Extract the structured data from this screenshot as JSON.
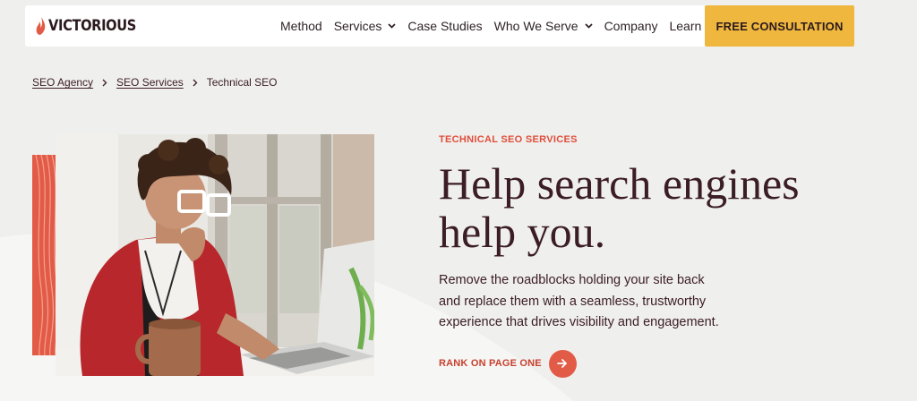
{
  "brand": {
    "name": "VICTORIOUS",
    "accent": "#e25b47",
    "cta_color": "#efb73e",
    "text_color": "#3b1d24"
  },
  "nav": {
    "items": [
      {
        "label": "Method"
      },
      {
        "label": "Services",
        "dropdown": true
      },
      {
        "label": "Case Studies"
      },
      {
        "label": "Who We Serve",
        "dropdown": true
      },
      {
        "label": "Company"
      },
      {
        "label": "Learn"
      }
    ],
    "cta": "FREE CONSULTATION"
  },
  "breadcrumb": [
    "SEO Agency",
    "SEO Services",
    "Technical SEO"
  ],
  "hero": {
    "eyebrow": "TECHNICAL SEO SERVICES",
    "headline_line1": "Help search engines",
    "headline_line2": "help you.",
    "description_lines": [
      "Remove the roadblocks holding your site back",
      "and replace them with a seamless, trustworthy",
      "experience that drives visibility and engagement."
    ],
    "cta_label": "RANK ON PAGE ONE",
    "cta_icon": "arrow-right-icon",
    "image": "person-with-glasses-at-laptop"
  },
  "icons": {
    "logo": "flame-icon",
    "dropdown": "chevron-down-icon",
    "breadcrumb_separator": "chevron-right-icon"
  }
}
